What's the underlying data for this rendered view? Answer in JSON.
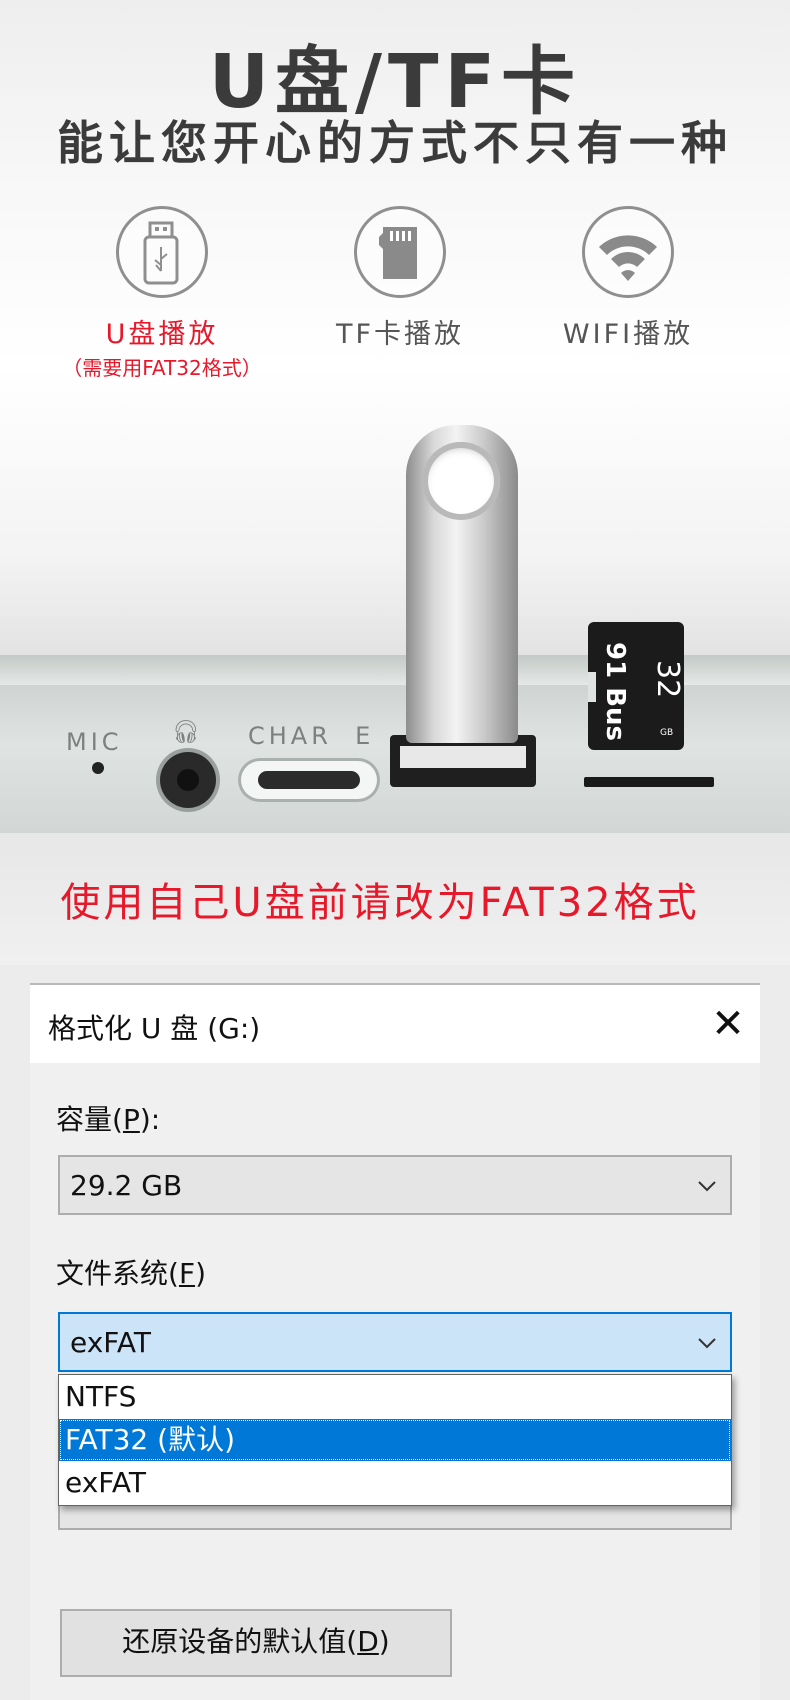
{
  "promo": {
    "title_line1": "U盘/TF卡",
    "title_line2": "能让您开心的方式不只有一种",
    "features": [
      {
        "label": "U盘播放",
        "note": "（需要用FAT32格式）",
        "icon": "usb-drive-icon"
      },
      {
        "label": "TF卡播放",
        "icon": "sd-card-icon"
      },
      {
        "label": "WIFI播放",
        "icon": "wifi-icon"
      }
    ],
    "device_labels": {
      "mic": "MIC",
      "charge": "CHAR  E"
    },
    "tf_card": {
      "brand": "91 Bus",
      "capacity": "32",
      "unit": "GB"
    },
    "warning": "使用自己U盘前请改为FAT32格式",
    "accent_color": "#e6192b"
  },
  "dialog": {
    "title": "格式化 U 盘 (G:)",
    "close_glyph": "✕",
    "capacity_label": "容量",
    "capacity_key": "P",
    "capacity_value": "29.2 GB",
    "filesystem_label": "文件系统",
    "filesystem_key": "F",
    "filesystem_value": "exFAT",
    "filesystem_options": [
      "NTFS",
      "FAT32 (默认)",
      "exFAT"
    ],
    "selected_option_index": 1,
    "restore_button": "还原设备的默认值",
    "restore_key": "D",
    "highlight_color": "#0078d7"
  }
}
